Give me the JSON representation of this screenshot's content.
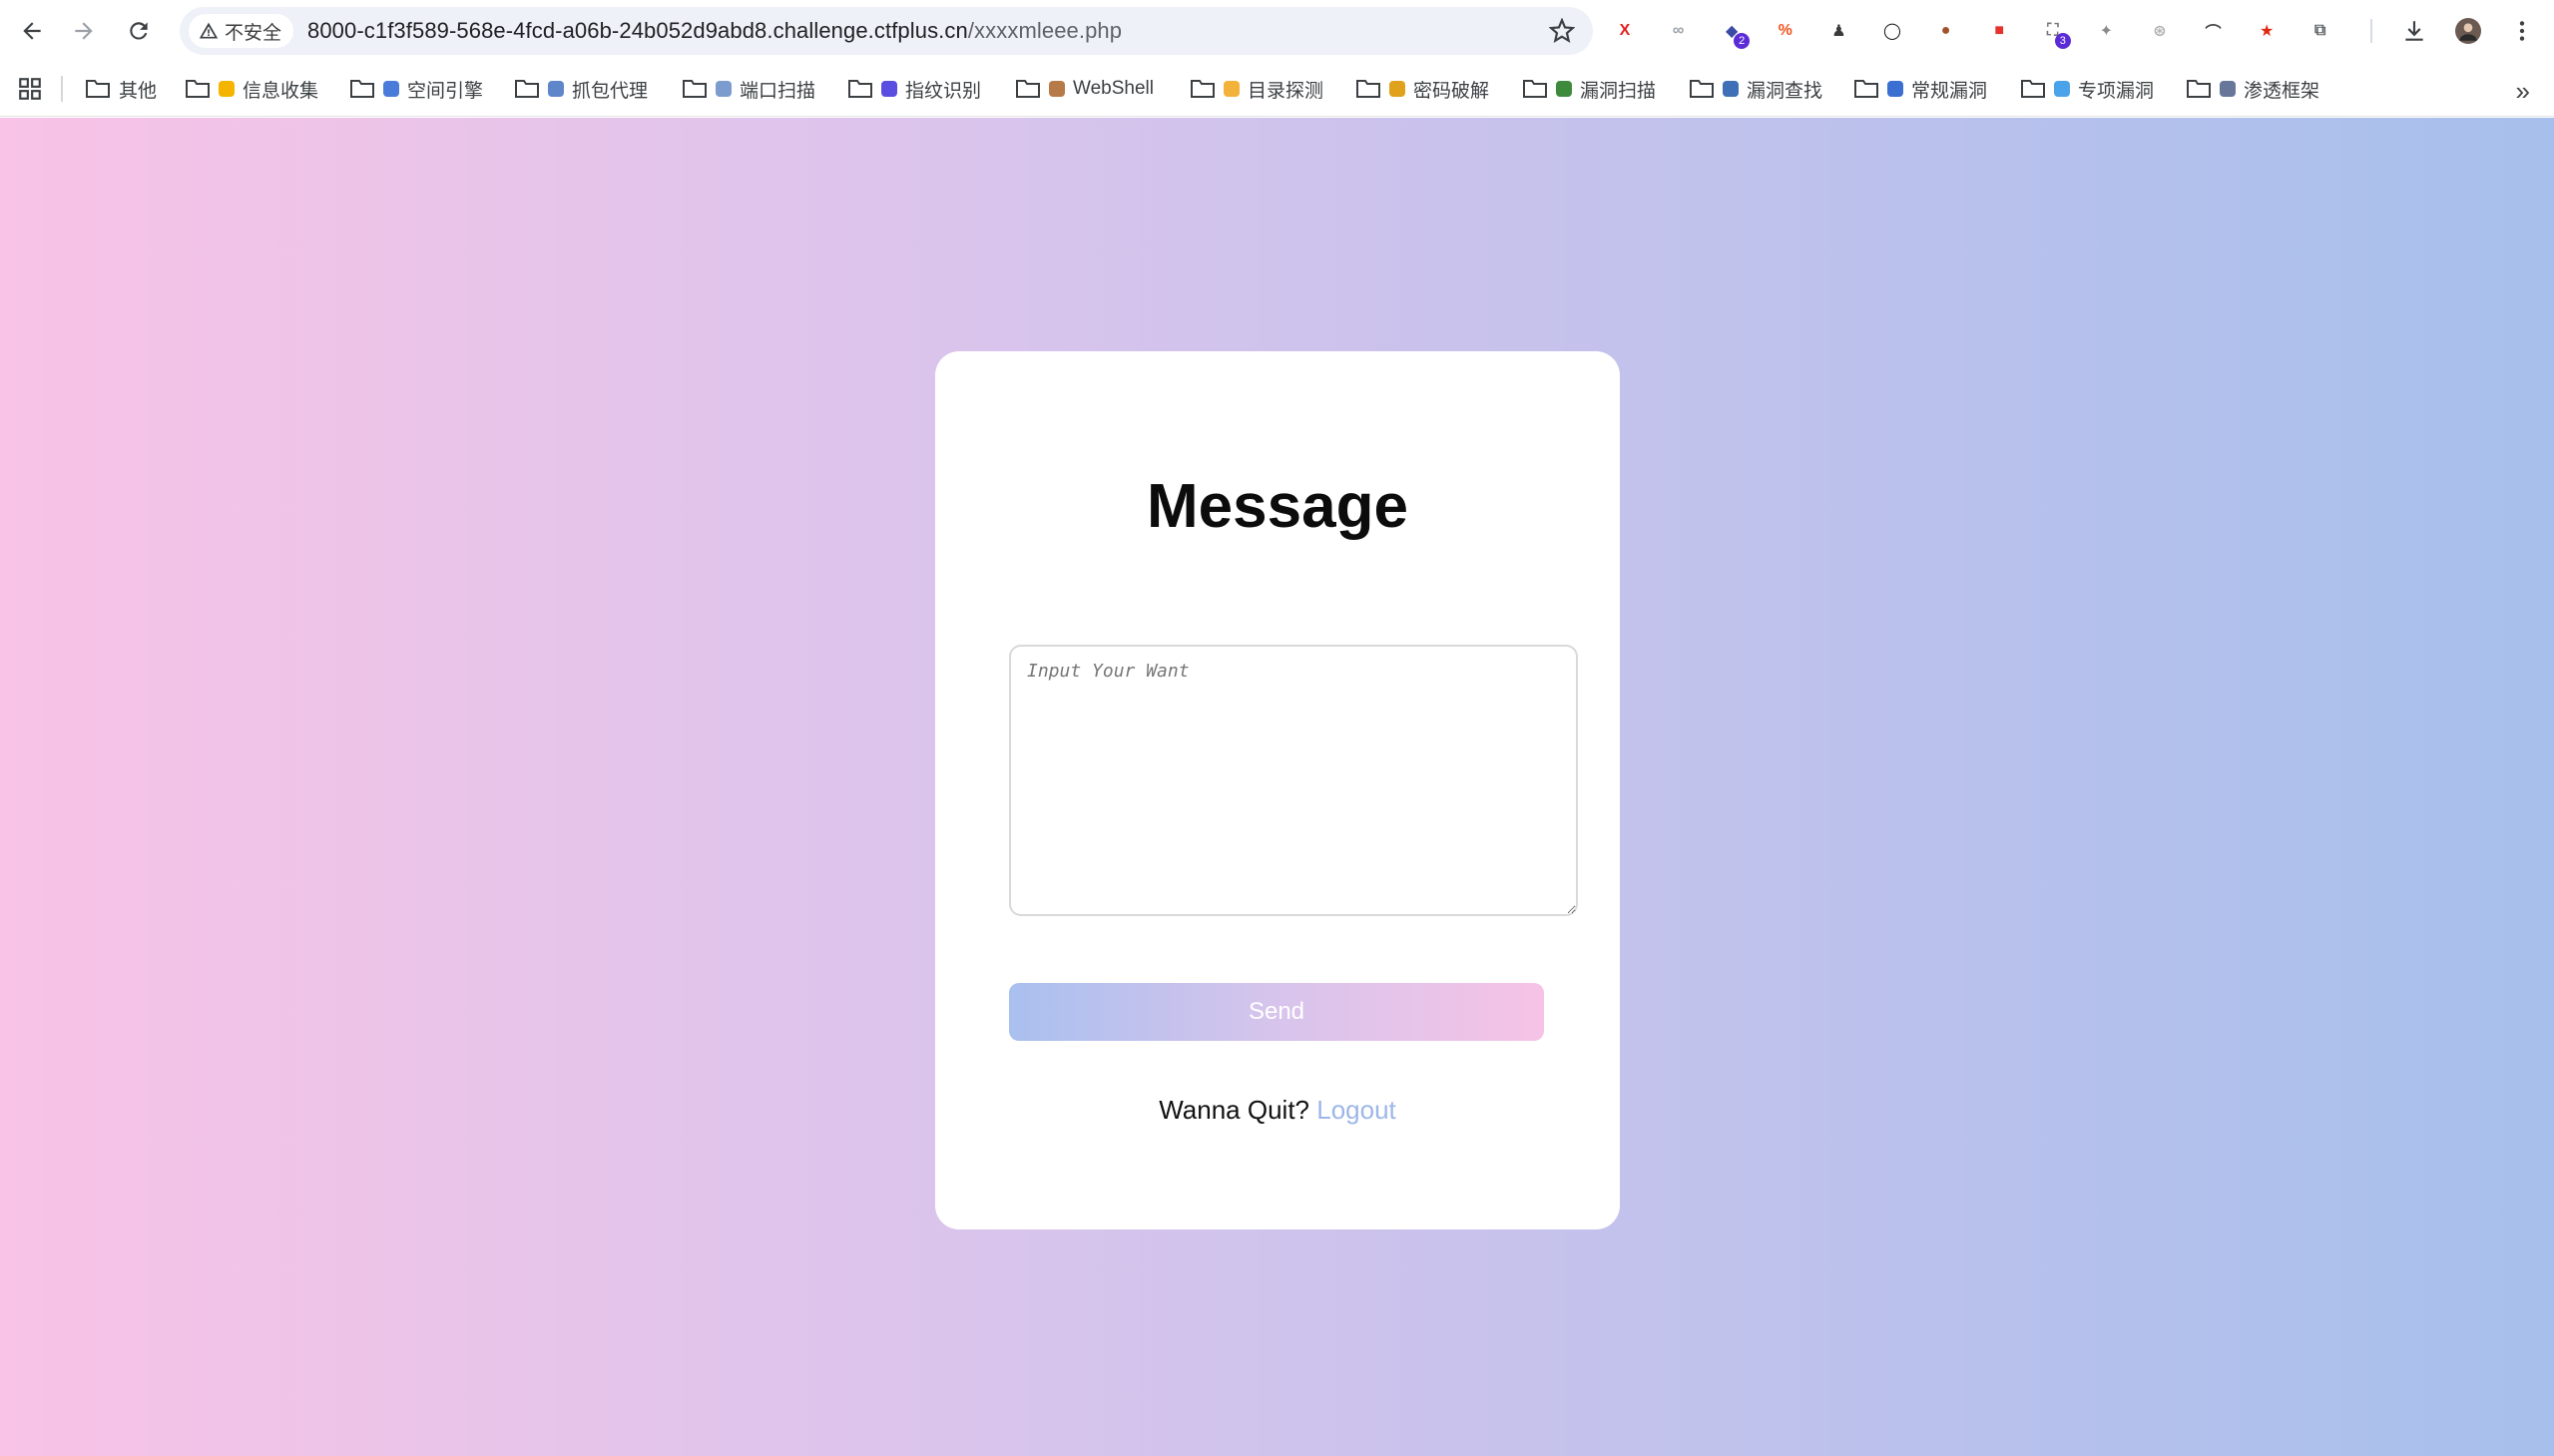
{
  "browser": {
    "security_label": "不安全",
    "url_host": "8000-c1f3f589-568e-4fcd-a06b-24b052d9abd8.challenge.ctfplus.cn",
    "url_path": "/xxxxmleee.php",
    "extensions": [
      {
        "name": "x-extension-icon",
        "glyph": "X",
        "color": "#e0201f",
        "badge": ""
      },
      {
        "name": "link-extension-icon",
        "glyph": "∞",
        "color": "#9aa0a6",
        "badge": ""
      },
      {
        "name": "hat-extension-icon",
        "glyph": "◆",
        "color": "#3b4aa5",
        "badge": "2"
      },
      {
        "name": "percent-extension-icon",
        "glyph": "%",
        "color": "#f0561e",
        "badge": ""
      },
      {
        "name": "spy-extension-icon",
        "glyph": "♟",
        "color": "#3a3a3a",
        "badge": ""
      },
      {
        "name": "circle-extension-icon",
        "glyph": "◯",
        "color": "#111111",
        "badge": ""
      },
      {
        "name": "cookie-extension-icon",
        "glyph": "●",
        "color": "#a0522d",
        "badge": ""
      },
      {
        "name": "cube-extension-icon",
        "glyph": "■",
        "color": "#e5322d",
        "badge": ""
      },
      {
        "name": "scan-extension-icon",
        "glyph": "⛶",
        "color": "#777777",
        "badge": "3"
      },
      {
        "name": "bird-extension-icon",
        "glyph": "✦",
        "color": "#8a8a8a",
        "badge": ""
      },
      {
        "name": "shield-extension-icon",
        "glyph": "⊛",
        "color": "#b0b0b0",
        "badge": ""
      },
      {
        "name": "hat2-extension-icon",
        "glyph": "⌒",
        "color": "#444444",
        "badge": ""
      },
      {
        "name": "flag-extension-icon",
        "glyph": "★",
        "color": "#de2910",
        "badge": ""
      },
      {
        "name": "puzzle-extension-icon",
        "glyph": "⧉",
        "color": "#5f6368",
        "badge": ""
      }
    ]
  },
  "bookmarks": [
    {
      "label": "其他",
      "icon": "",
      "color": ""
    },
    {
      "label": "信息收集",
      "icon": "bulb-icon",
      "color": "#f4b400"
    },
    {
      "label": "空间引擎",
      "icon": "mailbox-icon",
      "color": "#4a7bd9"
    },
    {
      "label": "抓包代理",
      "icon": "plane-icon",
      "color": "#5f86c9"
    },
    {
      "label": "端口扫描",
      "icon": "ufo-icon",
      "color": "#7c9ccf"
    },
    {
      "label": "指纹识别",
      "icon": "swirl-icon",
      "color": "#5a4ee0"
    },
    {
      "label": "WebShell",
      "icon": "box-icon",
      "color": "#b57a48"
    },
    {
      "label": "目录探测",
      "icon": "folder-icon",
      "color": "#f3b23a"
    },
    {
      "label": "密码破解",
      "icon": "lock-icon",
      "color": "#e0a21d"
    },
    {
      "label": "漏洞扫描",
      "icon": "bug-icon",
      "color": "#3d8a3d"
    },
    {
      "label": "漏洞查找",
      "icon": "magnifier-icon",
      "color": "#3f6fb6"
    },
    {
      "label": "常规漏洞",
      "icon": "target-icon",
      "color": "#3b6fd1"
    },
    {
      "label": "专项漏洞",
      "icon": "gem-icon",
      "color": "#4aa3e8"
    },
    {
      "label": "渗透框架",
      "icon": "tools-icon",
      "color": "#667799"
    }
  ],
  "page": {
    "title": "Message",
    "textarea_placeholder": "Input Your Want",
    "send_label": "Send",
    "quit_text": "Wanna Quit?",
    "logout_label": "Logout"
  }
}
